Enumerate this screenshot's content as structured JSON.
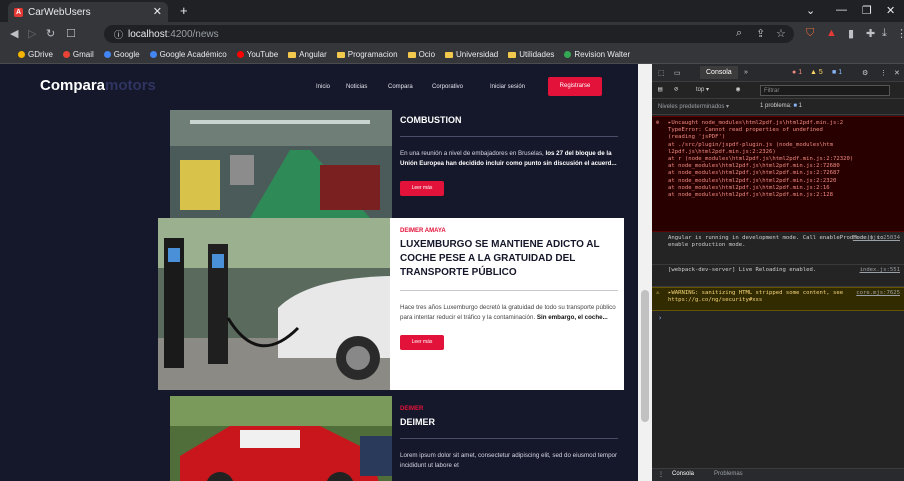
{
  "browser": {
    "tab_title": "CarWebUsers",
    "tab_favicon_letter": "A",
    "url_host": "localhost",
    "url_path": ":4200/news",
    "bookmarks": [
      {
        "label": "GDrive",
        "icon": "drive-icon"
      },
      {
        "label": "Gmail",
        "icon": "gmail-icon"
      },
      {
        "label": "Google",
        "icon": "google-icon"
      },
      {
        "label": "Google Académico",
        "icon": "scholar-icon"
      },
      {
        "label": "YouTube",
        "icon": "youtube-icon"
      },
      {
        "label": "Angular",
        "icon": "folder-icon"
      },
      {
        "label": "Programacion",
        "icon": "folder-icon"
      },
      {
        "label": "Ocio",
        "icon": "folder-icon"
      },
      {
        "label": "Universidad",
        "icon": "folder-icon"
      },
      {
        "label": "Utilidades",
        "icon": "folder-icon"
      },
      {
        "label": "Revision Walter",
        "icon": "globe-icon"
      }
    ]
  },
  "site": {
    "logo_main": "Compara",
    "logo_sub": "motors",
    "nav": [
      "Inicio",
      "Noticias",
      "Compara",
      "Corporativo",
      "Iniciar sesión"
    ],
    "register_label": "Registrarse",
    "cards": [
      {
        "author": "",
        "title": "COMBUSTION",
        "body": "En una reunión a nivel de embajadores en Bruselas, ",
        "body_bold": "los 27 del bloque de la Unión Europea han decidido incluir como punto sin discusión el acuerd...",
        "button": "Leer más"
      },
      {
        "author": "DEIMER AMAYA",
        "title": "LUXEMBURGO SE MANTIENE ADICTO AL COCHE PESE A LA GRATUIDAD DEL TRANSPORTE PÚBLICO",
        "body": "Hace tres años Luxemburgo decretó la gratuidad de todo su transporte público para intentar reducir el tráfico y la contaminación. ",
        "body_bold": "Sin embargo, el coche...",
        "button": "Leer más"
      },
      {
        "author": "DEIMER",
        "title": "DEIMER",
        "body": "Lorem ipsum dolor sit amet, consectetur adipiscing elit, sed do eiusmod tempor incididunt ut labore et",
        "body_bold": "",
        "button": "Leer más"
      }
    ]
  },
  "devtools": {
    "tabs": [
      "Consola"
    ],
    "error_count": "1",
    "warning_count": "5",
    "info_count": "1",
    "context": "top",
    "filter_placeholder": "Filtrar",
    "levels": "Niveles predeterminados",
    "issues": "1 problema: ",
    "issues_count": "1",
    "error_lines": [
      "▸Uncaught  node_modules\\html2pdf.js\\html2pdf.min.js:2",
      "TypeError: Cannot read properties of undefined",
      "(reading 'jsPDF')",
      "    at ./src/plugin/jspdf-plugin.js (node_modules\\htm",
      "l2pdf.js\\html2pdf.min.js:2:2326)",
      "    at r (node_modules\\html2pdf.js\\html2pdf.min.js:2:72320)",
      "    at node_modules\\html2pdf.js\\html2pdf.min.js:2:72680",
      "    at node_modules\\html2pdf.js\\html2pdf.min.js:2:72687",
      "    at node_modules\\html2pdf.js\\html2pdf.min.js:2:2320",
      "    at node_modules\\html2pdf.js\\html2pdf.min.js:2:16",
      "    at node_modules\\html2pdf.js\\html2pdf.min.js:2:128"
    ],
    "messages": [
      {
        "text": "Angular is running in development mode. Call enableProdMode() to enable production mode.",
        "src": "core.mjs:25034"
      },
      {
        "text": "[webpack-dev-server] Live Reloading enabled.",
        "src": "index.js:551"
      }
    ],
    "warning": {
      "text": "▸WARNING: sanitizing HTML stripped some content, see https://g.co/ng/security#xss",
      "src": "core.mjs:7625"
    },
    "bottom_tabs": [
      "Consola",
      "Problemas"
    ]
  }
}
